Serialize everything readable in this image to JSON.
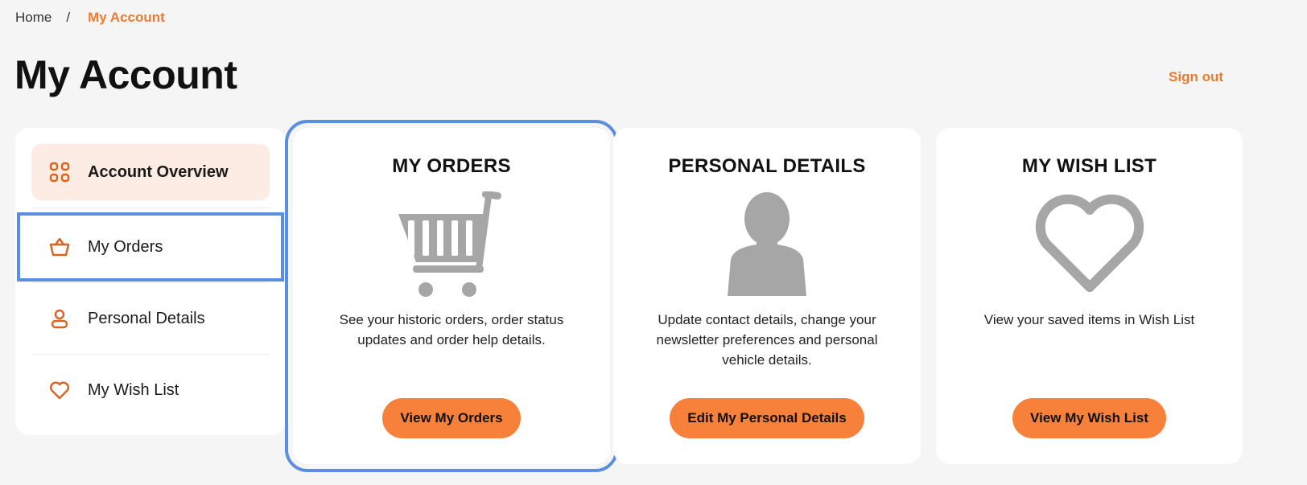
{
  "breadcrumb": {
    "home": "Home",
    "separator": "/",
    "current": "My Account"
  },
  "page_title": "My Account",
  "sign_out": "Sign out",
  "sidebar": {
    "items": [
      {
        "label": "Account Overview",
        "icon": "grid-icon",
        "active": true
      },
      {
        "label": "My Orders",
        "icon": "basket-icon"
      },
      {
        "label": "Personal Details",
        "icon": "user-icon"
      },
      {
        "label": "My Wish List",
        "icon": "heart-icon"
      }
    ]
  },
  "cards": [
    {
      "title": "MY ORDERS",
      "icon": "shopping-cart-icon",
      "description": "See your historic orders, order status updates and order help details.",
      "button": "View My Orders"
    },
    {
      "title": "PERSONAL DETAILS",
      "icon": "person-silhouette-icon",
      "description": "Update contact details, change your newsletter preferences and personal vehicle details.",
      "button": "Edit My Personal Details"
    },
    {
      "title": "MY WISH LIST",
      "icon": "heart-outline-icon",
      "description": "View your saved items in Wish List",
      "button": "View My Wish List"
    }
  ],
  "colors": {
    "accent": "#f07a2b",
    "button": "#f7813a",
    "active_bg": "#fdece3",
    "focus_outline": "#5b8de0",
    "illustration": "#a6a6a6"
  }
}
